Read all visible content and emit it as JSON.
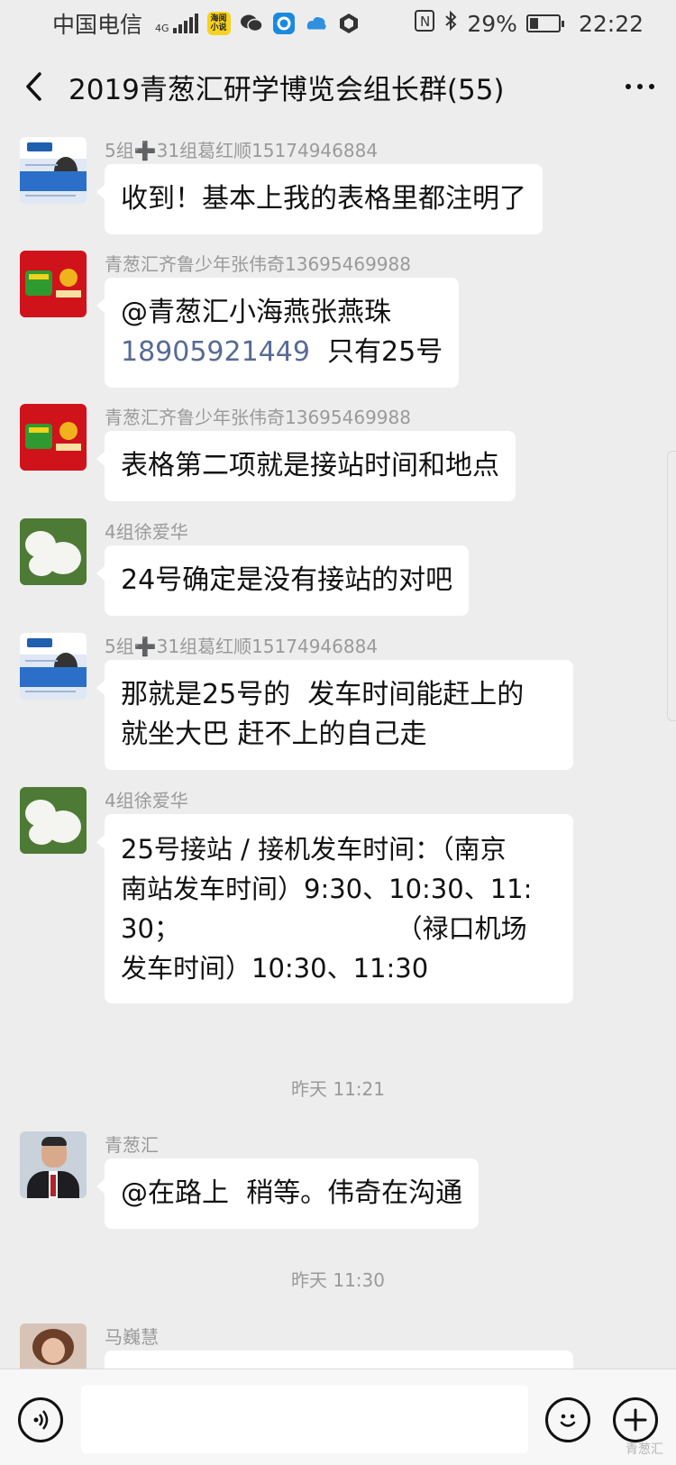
{
  "status_bar": {
    "carrier": "中国电信",
    "network": "4G",
    "app_icon_label": "海阅小说",
    "battery": "29%",
    "battery_level": 0.29,
    "time": "22:22"
  },
  "header": {
    "title": "2019青葱汇研学博览会组长群(55)"
  },
  "messages": [
    {
      "sender": "5组➕31组葛红顺15174946884",
      "text": "收到！基本上我的表格里都注明了"
    },
    {
      "sender": "青葱汇齐鲁少年张伟奇13695469988",
      "text_before": "@青葱汇小海燕张燕珠\n",
      "phone": "18905921449",
      "text_after": "  只有25号"
    },
    {
      "sender": "青葱汇齐鲁少年张伟奇13695469988",
      "text": "表格第二项就是接站时间和地点"
    },
    {
      "sender": "4组徐爱华",
      "text": "24号确定是没有接站的对吧"
    },
    {
      "sender": "5组➕31组葛红顺15174946884",
      "text": "那就是25号的  发车时间能赶上的\n就坐大巴 赶不上的自己走"
    },
    {
      "sender": "4组徐爱华",
      "text": "25号接站 / 接机发车时间：（南京\n南站发车时间）9:30、10:30、11:\n30；                          （禄口机场\n发车时间）10:30、11:30"
    },
    {
      "sender": "青葱汇",
      "text": "@在路上  稍等。伟奇在沟通"
    },
    {
      "sender": "马巍慧",
      "text": ""
    }
  ],
  "timestamps": [
    "昨天 11:21",
    "昨天 11:30"
  ],
  "input": {
    "placeholder": ""
  },
  "watermark": "青葱汇"
}
